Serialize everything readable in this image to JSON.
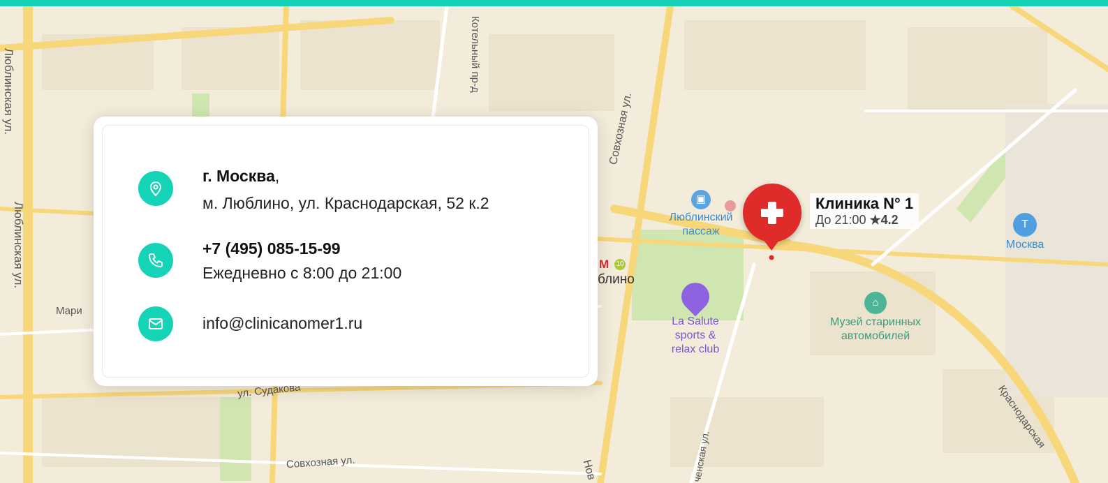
{
  "map": {
    "streets": {
      "lyublinskaya_1": "Люблинская ул.",
      "lyublinskaya_2": "Люблинская ул.",
      "kotelny": "Котельный пр-д",
      "sovkhoznaya_1": "Совхозная ул.",
      "sovkhoznaya_2": "Совхозная ул.",
      "sudakova": "ул. Судакова",
      "krasnodarskaya": "Краснодарская",
      "mariu": "Мари",
      "nov": "Нов",
      "chenskaya": "ченская ул.",
      "lyublino_metro": "блино"
    },
    "metro_line": "10",
    "pois": {
      "passage": "Люблинский пассаж",
      "passage_line1": "Люблинский",
      "passage_line2": "пассаж",
      "salute_line1": "La Salute",
      "salute_line2": "sports &",
      "salute_line3": "relax club",
      "museum_line1": "Музей старинных",
      "museum_line2": "автомобилей",
      "moskva": "Москва"
    },
    "clinic_pin": {
      "title": "Клиника N° 1",
      "hours": "До 21:00",
      "rating": "★4.2"
    }
  },
  "contact_card": {
    "city": "г. Москва",
    "city_comma": ",",
    "address": "м. Люблино, ул. Краснодарская, 52 к.2",
    "phone": "+7 (495) 085-15-99",
    "schedule": "Ежедневно с 8:00 до 21:00",
    "email": "info@clinicanomer1.ru",
    "icons": [
      "location-pin-icon",
      "phone-icon",
      "mail-icon"
    ]
  },
  "colors": {
    "accent": "#14d3b6",
    "pin_red": "#e02b2b",
    "map_bg": "#f4ecda",
    "road_yellow": "#f7d77a"
  }
}
